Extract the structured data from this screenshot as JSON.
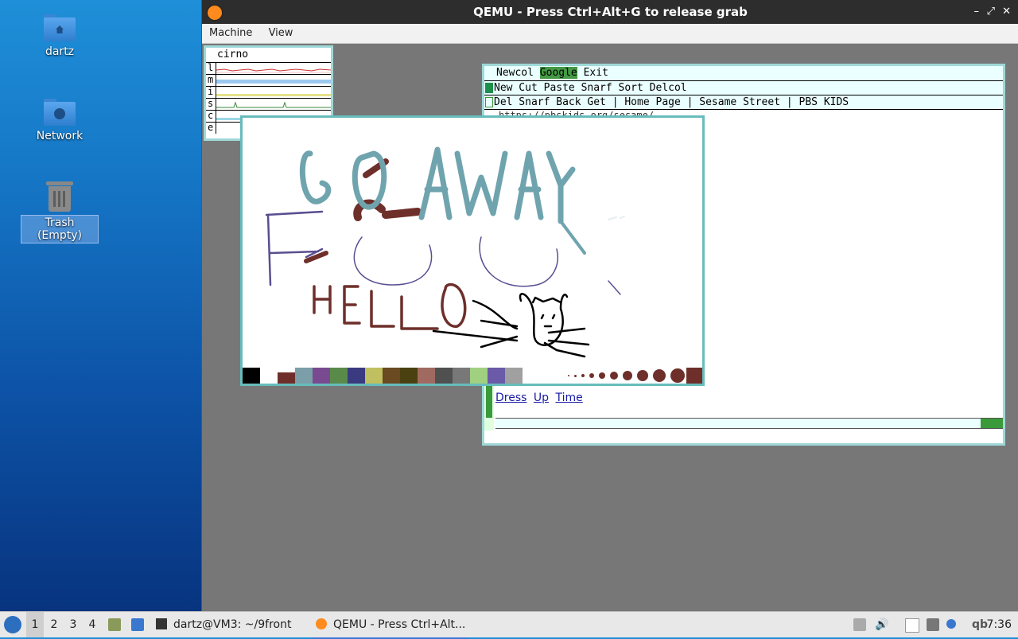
{
  "desktop": {
    "icons": [
      {
        "label": "dartz",
        "icon": "home-folder-icon"
      },
      {
        "label": "Network",
        "icon": "network-folder-icon"
      },
      {
        "label": "Trash (Empty)",
        "icon": "trash-icon"
      }
    ]
  },
  "window": {
    "title": "QEMU - Press Ctrl+Alt+G to release grab",
    "controls": [
      "–",
      "⤢",
      "✕"
    ],
    "menu": [
      "Machine",
      "View"
    ]
  },
  "stats": {
    "hostname": "cirno",
    "rows": [
      "l",
      "m",
      "i",
      "s",
      "c",
      "e"
    ]
  },
  "acme": {
    "tag_items": [
      "Newcol",
      "Google",
      "Exit"
    ],
    "column_tag": "New Cut Paste Snarf Sort Delcol",
    "window_tag": "Del Snarf Back Get | Home Page | Sesame Street | PBS KIDS",
    "url_partial": "https://pbskids.org/sesame/",
    "links": [
      "Dress",
      "Up",
      "Time"
    ]
  },
  "paint": {
    "palette": [
      "#000000",
      "#ffffff",
      "#6e2f2a",
      "#7a9fa8",
      "#7a4a90",
      "#5a8a4a",
      "#3a3a80",
      "#c0c060",
      "#6a4a20",
      "#4a4010",
      "#a06a60",
      "#505050",
      "#787878",
      "#a0d080",
      "#6a5aa8",
      "#a0a0a0"
    ],
    "brush_color": "#6e2f2a",
    "drawing_text": [
      "GO AWAY",
      "HELLO"
    ]
  },
  "taskbar": {
    "workspaces": [
      "1",
      "2",
      "3",
      "4"
    ],
    "active_workspace": "1",
    "tasks": [
      {
        "label": "dartz@VM3: ~/9front",
        "icon": "terminal-icon"
      },
      {
        "label": "QEMU - Press Ctrl+Alt...",
        "icon": "qemu-icon"
      }
    ],
    "tray_text": "qb",
    "clock": "7:36"
  }
}
